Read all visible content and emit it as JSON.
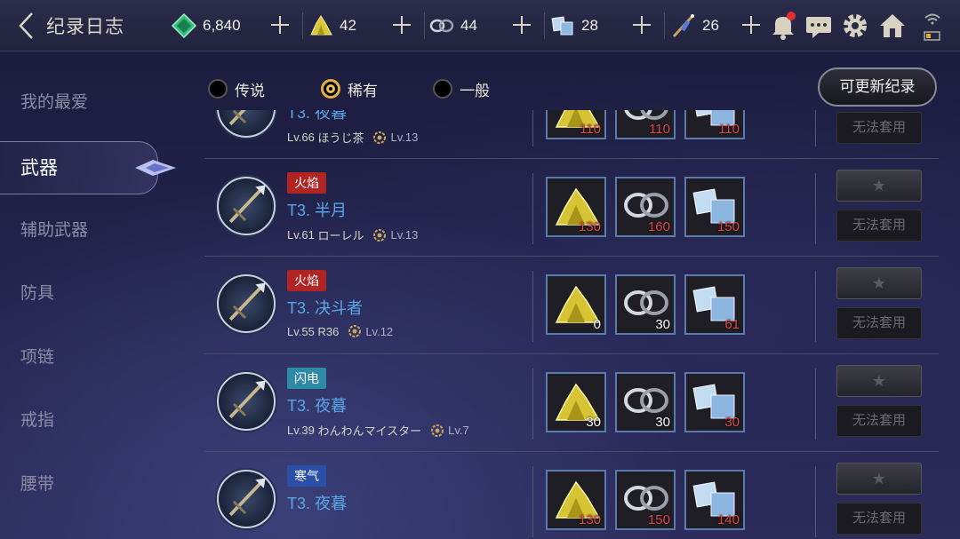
{
  "header": {
    "title": "纪录日志"
  },
  "currencies": [
    {
      "icon": "green-gem-icon",
      "value": "6,840"
    },
    {
      "icon": "gold-ore-icon",
      "value": "42"
    },
    {
      "icon": "silver-ring-icon",
      "value": "44"
    },
    {
      "icon": "ice-crystal-icon",
      "value": "28"
    },
    {
      "icon": "dagger-scroll-icon",
      "value": "26"
    }
  ],
  "sidebar": {
    "items": [
      "我的最爱",
      "武器",
      "辅助武器",
      "防具",
      "项链",
      "戒指",
      "腰带"
    ],
    "active": "武器"
  },
  "filters": [
    {
      "label": "传说",
      "selected": false
    },
    {
      "label": "稀有",
      "selected": true
    },
    {
      "label": "一般",
      "selected": false
    }
  ],
  "update_button": "可更新纪录",
  "rows": [
    {
      "element": "",
      "element_color": "",
      "name": "T3. 夜暮",
      "level": "Lv.66",
      "owner": "ほうじ茶",
      "gear_level": "Lv.13",
      "mats": [
        "110",
        "110",
        "110"
      ],
      "mats_red": [
        true,
        true,
        true
      ],
      "apply": "无法套用"
    },
    {
      "element": "火焰",
      "element_color": "#b02424",
      "name": "T3. 半月",
      "level": "Lv.61",
      "owner": "ローレル",
      "gear_level": "Lv.13",
      "mats": [
        "130",
        "160",
        "150"
      ],
      "mats_red": [
        true,
        true,
        true
      ],
      "apply": "无法套用"
    },
    {
      "element": "火焰",
      "element_color": "#b02424",
      "name": "T3. 决斗者",
      "level": "Lv.55",
      "owner": "R36",
      "gear_level": "Lv.12",
      "mats": [
        "0",
        "30",
        "61"
      ],
      "mats_red": [
        false,
        false,
        true
      ],
      "apply": "无法套用"
    },
    {
      "element": "闪电",
      "element_color": "#2f8aa8",
      "name": "T3. 夜暮",
      "level": "Lv.39",
      "owner": "わんわんマイスター",
      "gear_level": "Lv.7",
      "mats": [
        "30",
        "30",
        "30"
      ],
      "mats_red": [
        false,
        false,
        true
      ],
      "apply": "无法套用"
    },
    {
      "element": "寒气",
      "element_color": "#2a4fa8",
      "name": "T3. 夜暮",
      "level": "",
      "owner": "",
      "gear_level": "",
      "mats": [
        "130",
        "150",
        "140"
      ],
      "mats_red": [
        true,
        true,
        true
      ],
      "apply": "无法套用"
    }
  ],
  "star_glyph": "★"
}
